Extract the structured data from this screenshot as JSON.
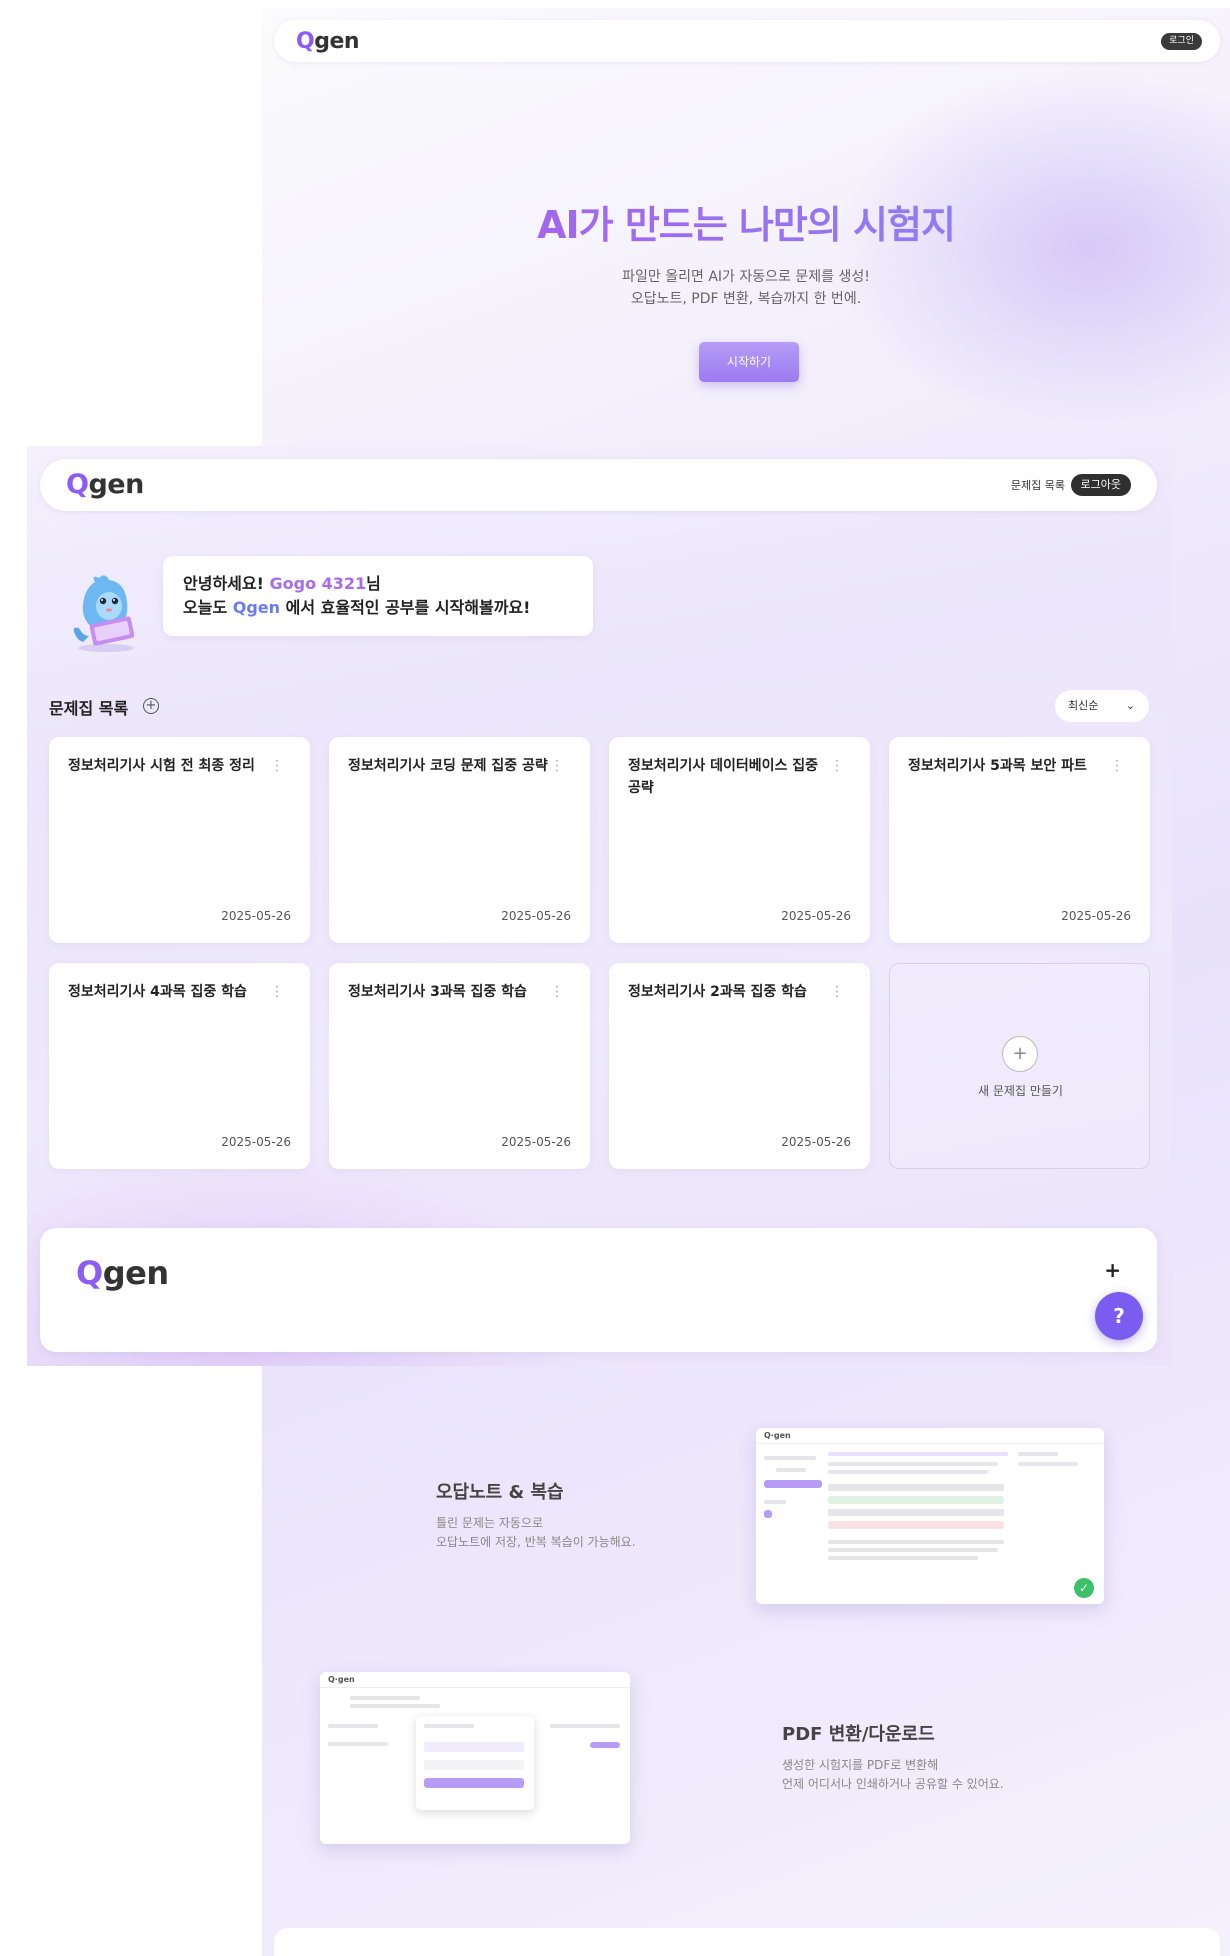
{
  "landing": {
    "logo": "Qgen",
    "login_label": "로그인",
    "hero_title": "AI가 만드는 나만의 시험지",
    "hero_sub_line1": "파일만 올리면 AI가 자동으로 문제를 생성!",
    "hero_sub_line2": "오답노트, PDF 변환, 복습까지 한 번에.",
    "start_label": "시작하기",
    "feature_review_title": "오답노트 & 복습",
    "feature_review_line1": "틀린 문제는 자동으로",
    "feature_review_line2": "오답노트에 저장, 반복 복습이 가능해요.",
    "feature_pdf_title": "PDF 변환/다운로드",
    "feature_pdf_line1": "생성한 시험지를 PDF로 변환해",
    "feature_pdf_line2": "언제 어디서나 인쇄하거나 공유할 수 있어요."
  },
  "dashboard": {
    "logo": "Qgen",
    "nav_link": "문제집 목록",
    "logout_label": "로그아웃",
    "greet_prefix": "안녕하세요!",
    "greet_user": "Gogo 4321",
    "greet_suffix": "님",
    "greet_line2_prefix": "오늘도",
    "greet_brand": "Qgen",
    "greet_line2_suffix": "에서 효율적인 공부를 시작해볼까요!",
    "section_title": "문제집 목록",
    "sort_label": "최신순",
    "cards": [
      {
        "title": "정보처리기사 시험 전 최종 정리",
        "date": "2025-05-26"
      },
      {
        "title": "정보처리기사 코딩 문제 집중 공략",
        "date": "2025-05-26"
      },
      {
        "title": "정보처리기사 데이터베이스 집중 공략",
        "date": "2025-05-26"
      },
      {
        "title": "정보처리기사 5과목 보안 파트",
        "date": "2025-05-26"
      },
      {
        "title": "정보처리기사 4과목 집중 학습",
        "date": "2025-05-26"
      },
      {
        "title": "정보처리기사 3과목 집중 학습",
        "date": "2025-05-26"
      },
      {
        "title": "정보처리기사 2과목 집중 학습",
        "date": "2025-05-26"
      }
    ],
    "new_card_label": "새 문제집 만들기",
    "footer_logo": "Qgen"
  },
  "icons": {
    "menu": "vertical-dots-icon",
    "add": "plus-icon",
    "sort": "chevron-down-icon",
    "help": "mascot-help-icon"
  },
  "colors": {
    "accent": "#8b5cf6",
    "button_purple": "#a98af4",
    "help_button": "#7b5cf0",
    "dark_pill": "#2f2f2f"
  }
}
